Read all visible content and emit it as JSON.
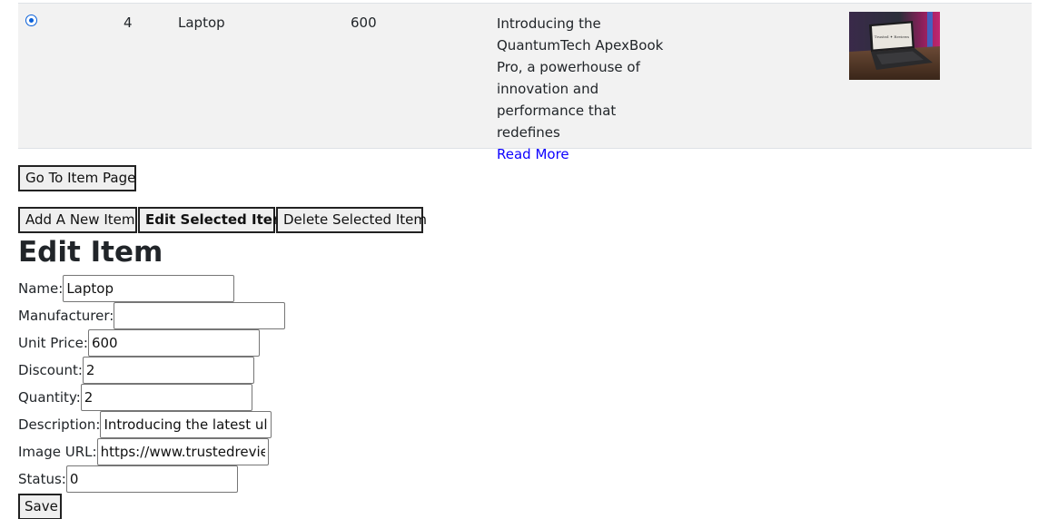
{
  "item": {
    "selected": true,
    "id": "4",
    "name": "Laptop",
    "price": "600",
    "description": "Introducing the QuantumTech ApexBook Pro, a powerhouse of innovation and performance that redefines",
    "read_more": "Read More",
    "image_brand_text": "Trusted Reviews"
  },
  "buttons": {
    "go_to_item": "Go To Item Page",
    "add_new": "Add A New Item",
    "edit_selected": "Edit Selected Item",
    "delete_selected": "Delete Selected Item",
    "save": "Save"
  },
  "form": {
    "heading": "Edit Item",
    "fields": {
      "name": {
        "label": "Name:",
        "value": "Laptop"
      },
      "manufacturer": {
        "label": "Manufacturer:",
        "value": ""
      },
      "unit_price": {
        "label": "Unit Price:",
        "value": "600"
      },
      "discount": {
        "label": "Discount:",
        "value": "2"
      },
      "quantity": {
        "label": "Quantity:",
        "value": "2"
      },
      "description": {
        "label": "Description:",
        "value": "Introducing the latest ultr"
      },
      "image_url": {
        "label": "Image URL:",
        "value": "https://www.trustedreview"
      },
      "status": {
        "label": "Status:",
        "value": "0"
      }
    }
  },
  "colors": {
    "row_background": "#f2f2f2",
    "link": "#0d00ff",
    "radio_accent": "#0b61d9"
  }
}
